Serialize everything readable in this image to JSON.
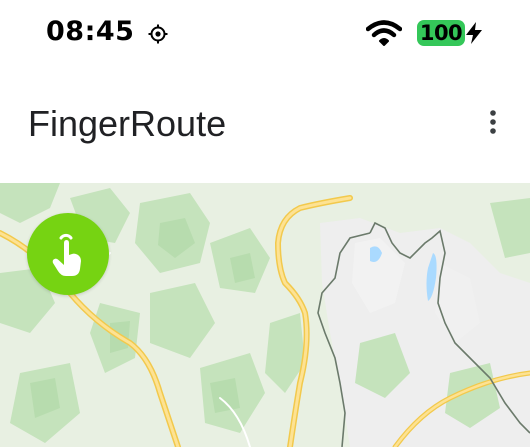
{
  "status_bar": {
    "time": "08:45",
    "location_icon": "location-target-icon",
    "wifi_icon": "wifi-icon",
    "battery_level": "100",
    "battery_color": "#34c759",
    "charging_icon": "bolt-icon"
  },
  "app_bar": {
    "title": "FingerRoute",
    "menu_icon": "more-vertical-icon"
  },
  "map": {
    "gesture_button_icon": "touch-finger-icon",
    "gesture_button_color": "#76d312"
  }
}
